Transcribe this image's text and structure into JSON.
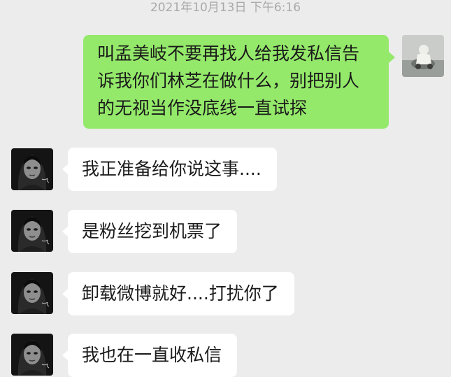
{
  "chat": {
    "timestamp": "2021年10月13日 下午6:16",
    "messages": [
      {
        "direction": "outgoing",
        "lines": [
          "叫孟美岐不要再找人给我发私信告",
          "诉我你们林芝在做什么，别把别人",
          "的无视当作没底线一直试探"
        ],
        "avatar_icon": "photo-avatar-icon"
      },
      {
        "direction": "incoming",
        "text": "我正准备给你说这事....",
        "avatar_icon": "dark-portrait-avatar-icon"
      },
      {
        "direction": "incoming",
        "text": "是粉丝挖到机票了",
        "avatar_icon": "dark-portrait-avatar-icon"
      },
      {
        "direction": "incoming",
        "text": "卸载微博就好....打扰你了",
        "avatar_icon": "dark-portrait-avatar-icon"
      },
      {
        "direction": "incoming",
        "text": "我也在一直收私信",
        "avatar_icon": "dark-portrait-avatar-icon"
      }
    ]
  },
  "colors": {
    "background": "#ececec",
    "outgoing_bubble": "#94e96a",
    "incoming_bubble": "#ffffff",
    "timestamp_text": "#a9a9a9"
  }
}
